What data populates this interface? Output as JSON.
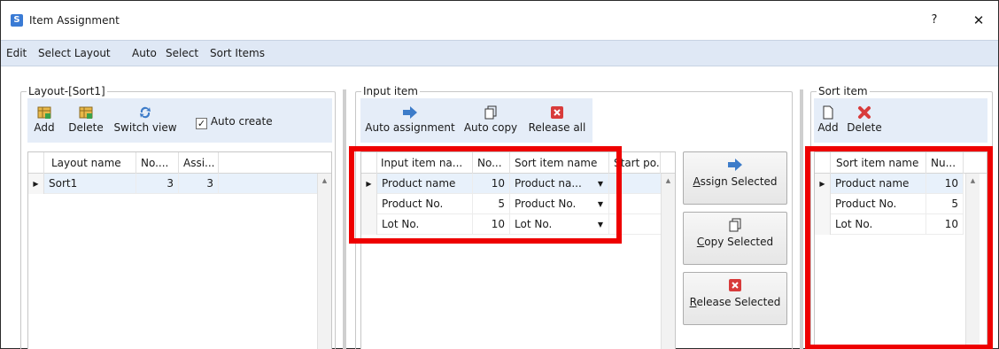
{
  "window": {
    "title": "Item Assignment",
    "app_icon_letter": "S",
    "help": "?",
    "close": "✕"
  },
  "menu": {
    "edit": "Edit",
    "select_layout": "Select Layout",
    "auto": "Auto",
    "select": "Select",
    "sort_items": "Sort Items"
  },
  "layout_group": {
    "title": "Layout-[Sort1]",
    "add": "Add",
    "delete": "Delete",
    "switch_view": "Switch view",
    "auto_create": "Auto create",
    "auto_create_checked": true,
    "headers": [
      "Layout name",
      "No....",
      "Assi..."
    ],
    "rows": [
      {
        "name": "Sort1",
        "no": "3",
        "assi": "3"
      }
    ]
  },
  "input_group": {
    "title": "Input item",
    "auto_assignment": "Auto assignment",
    "auto_copy": "Auto copy",
    "release_all": "Release all",
    "headers": [
      "Input item na...",
      "No...",
      "Sort item name",
      "Start po..."
    ],
    "rows": [
      {
        "input": "Product name",
        "no": "10",
        "sort": "Product na..."
      },
      {
        "input": "Product No.",
        "no": "5",
        "sort": "Product No."
      },
      {
        "input": "Lot No.",
        "no": "10",
        "sort": "Lot No."
      }
    ]
  },
  "actions": {
    "assign_selected_first": "A",
    "assign_selected_rest": "ssign Selected",
    "copy_selected_first": "C",
    "copy_selected_rest": "opy Selected",
    "release_selected_first": "R",
    "release_selected_rest": "elease Selected"
  },
  "sort_group": {
    "title": "Sort item",
    "add": "Add",
    "delete": "Delete",
    "headers": [
      "Sort item name",
      "Nu..."
    ],
    "rows": [
      {
        "name": "Product name",
        "nu": "10"
      },
      {
        "name": "Product No.",
        "nu": "5"
      },
      {
        "name": "Lot No.",
        "nu": "10"
      }
    ]
  },
  "colors": {
    "highlight": "#ee0000",
    "toolbar_bg": "#e5edf8",
    "menubar_bg": "#dfe8f5",
    "arrow_blue": "#3d7cc9",
    "delete_red": "#d83b3b"
  }
}
